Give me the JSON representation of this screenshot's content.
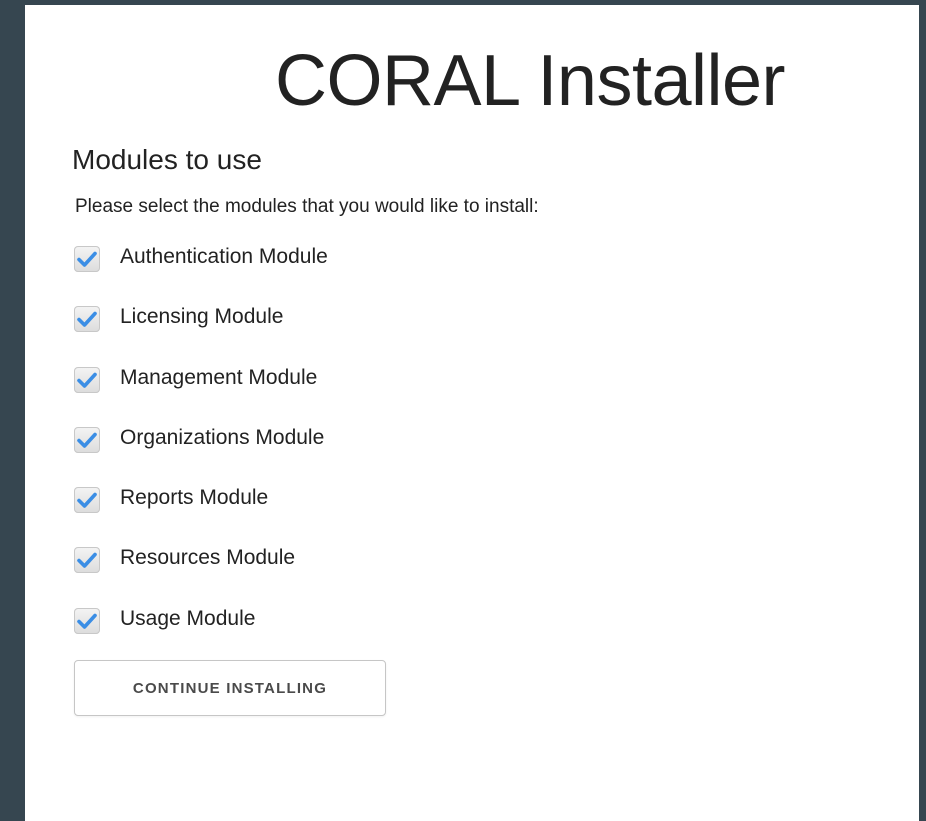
{
  "page": {
    "title": "CORAL Installer"
  },
  "section": {
    "heading": "Modules to use",
    "instruction": "Please select the modules that you would like to install:"
  },
  "modules": [
    {
      "label": "Authentication Module",
      "checked": true
    },
    {
      "label": "Licensing Module",
      "checked": true
    },
    {
      "label": "Management Module",
      "checked": true
    },
    {
      "label": "Organizations Module",
      "checked": true
    },
    {
      "label": "Reports Module",
      "checked": true
    },
    {
      "label": "Resources Module",
      "checked": true
    },
    {
      "label": "Usage Module",
      "checked": true
    }
  ],
  "actions": {
    "continue_label": "CONTINUE INSTALLING"
  },
  "icons": {
    "checkbox": "checkmark-icon"
  },
  "colors": {
    "background": "#364650",
    "panel": "#ffffff",
    "text": "#222222",
    "check": "#3b8ee5"
  }
}
